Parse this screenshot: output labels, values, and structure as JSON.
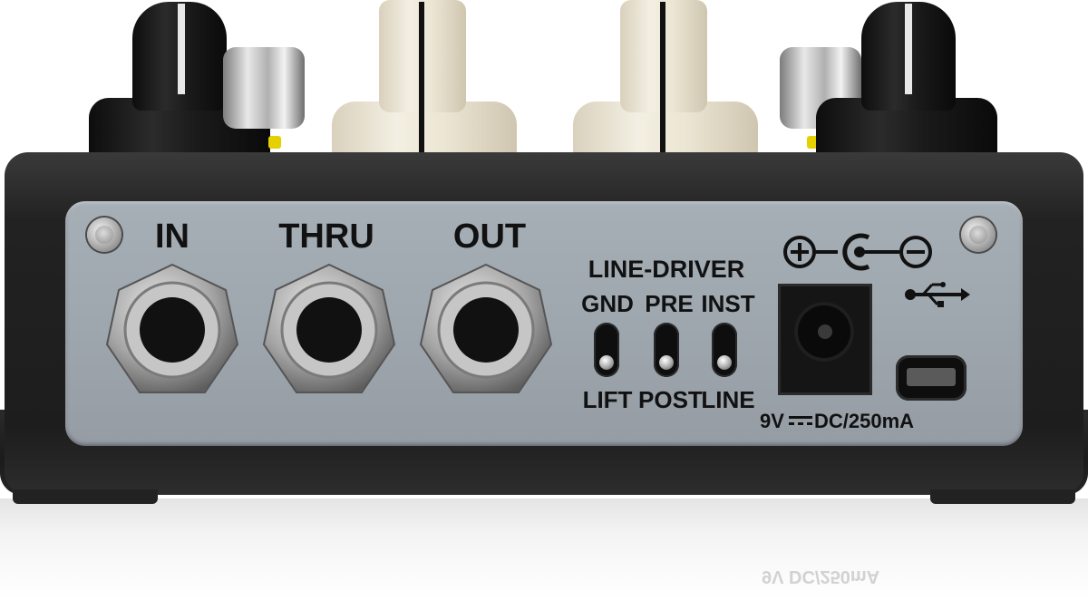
{
  "panel": {
    "jacks": [
      {
        "label": "IN"
      },
      {
        "label": "THRU"
      },
      {
        "label": "OUT"
      }
    ],
    "line_driver": {
      "title": "LINE-DRIVER",
      "switches": [
        {
          "top": "GND",
          "bottom": "LIFT"
        },
        {
          "top": "PRE",
          "bottom": "POST"
        },
        {
          "top": "INST",
          "bottom": "LINE"
        }
      ]
    },
    "power": {
      "polarity_icon": "center-negative-polarity-icon",
      "rating_left": "9V",
      "rating_right": "DC/250mA",
      "dc_symbol_icon": "dc-current-icon"
    },
    "usb": {
      "icon": "usb-icon"
    }
  },
  "colors": {
    "panel": "#9ea6ae",
    "chassis": "#1d1d1d",
    "knob_black": "#1a1a1a",
    "knob_cream": "#ece6d4",
    "text": "#111111"
  }
}
